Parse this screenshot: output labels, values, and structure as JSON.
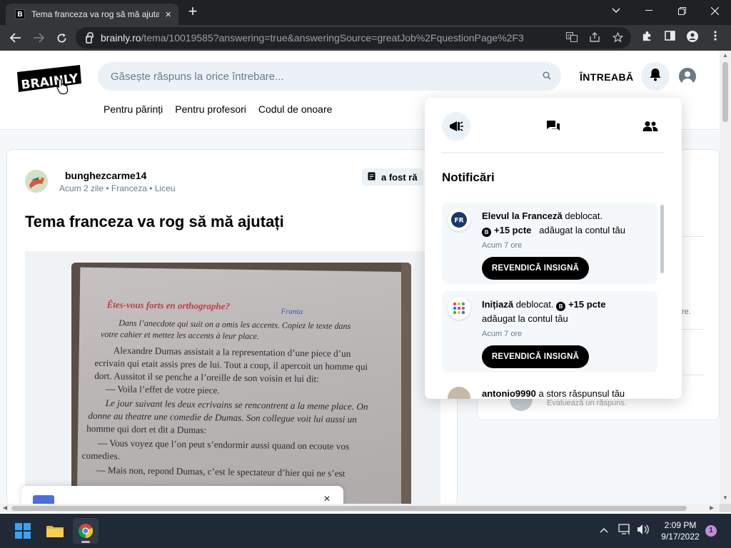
{
  "browser": {
    "tab_title": "Tema franceza va rog să mă ajutați",
    "tab_favicon": "B",
    "tab_close": "×",
    "new_tab": "+",
    "url_host": "brainly.ro",
    "url_path": "/tema/10019585?answering=true&answeringSource=greatJob%2FquestionPage%2F3",
    "icons": [
      "back-icon",
      "forward-icon",
      "reload-icon",
      "lock-icon",
      "translate-icon",
      "share-icon",
      "bookmark-star-icon",
      "extensions-icon",
      "sidepanel-icon",
      "profile-icon",
      "menu-icon"
    ]
  },
  "header": {
    "logo_text": "BRAINLY",
    "search_placeholder": "Găsește răspuns la orice întrebare...",
    "ask_label": "ÎNTREABĂ",
    "subnav": [
      "Pentru părinți",
      "Pentru profesori",
      "Codul de onoare"
    ]
  },
  "question": {
    "username": "bunghezcarme14",
    "time": "Acum 2 zile",
    "subject": "Franceza",
    "level": "Liceu",
    "bullet": "•",
    "badge": "a fost ră",
    "title": "Tema franceza va rog să mă ajutați"
  },
  "photo_text": {
    "heading": "Êtes-vous forts en orthographe?",
    "handwritten": "Franta",
    "instr1": "Dans l’anecdote qui suit on a omis les accents. Copiez le texte dans",
    "instr2": "votre cahier et mettez les accents à leur place.",
    "l1": "Alexandre Dumas assistait a la representation d’une piece d’un",
    "l2": "ecrivain qui etait assis pres de lui. Tout a coup, il apercoit un homme qui",
    "l3": "dort. Aussitot il se penche a l’oreille de son voisin et lui dit:",
    "l4": "— Voila l’effet de votre piece.",
    "l5": "Le jour suivant les deux ecrivains se rencontrent a la meme place. On",
    "l6": "donne au theatre une comedie de Dumas. Son collegue voit lui aussi un",
    "l7": "homme qui dort et dit a Dumas:",
    "l8": "— Vous voyez que l’on peut s’endormir aussi quand on ecoute vos",
    "l9": "comedies.",
    "l10": "— Mais non, repond Dumas, c’est le spectateur d’hier qui ne s’est"
  },
  "sidebar": {
    "partial_text": "re.",
    "rate_text": "Evaluează un răspuns."
  },
  "notifications": {
    "title": "Notificări",
    "tabs": [
      "megaphone-icon",
      "chat-bubbles-icon",
      "people-icon"
    ],
    "items": [
      {
        "icon_text": "FR",
        "pre": "Elevul la",
        "subject": "Franceză",
        "post": "deblocat.",
        "points": "+15 pcte",
        "suffix": "adăugat la contul tău",
        "time": "Acum 7 ore",
        "button": "REVENDICĂ INSIGNĂ"
      },
      {
        "name": "Inițiază",
        "post": "deblocat.",
        "points": "+15 pcte",
        "suffix": "adăugat la contul tău",
        "time": "Acum 7 ore",
        "button": "REVENDICĂ INSIGNĂ"
      }
    ],
    "partial_item": {
      "user": "antonio9990",
      "text": "a stors răspunsul tău"
    }
  },
  "taskbar": {
    "time": "2:09 PM",
    "date": "9/17/2022",
    "badge_count": "1",
    "apps": [
      "windows-start-icon",
      "file-explorer-icon",
      "chrome-icon"
    ]
  },
  "colors": {
    "brand_black": "#000000",
    "search_bg": "#ebf2f7",
    "heading_red": "#c33a3e"
  }
}
